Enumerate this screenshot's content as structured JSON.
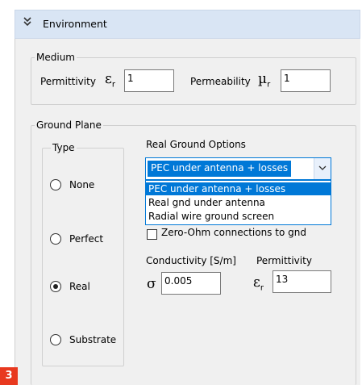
{
  "section": {
    "title": "Environment",
    "collapse_icon": "double-chevron-down-icon"
  },
  "medium": {
    "legend": "Medium",
    "permittivity_label": "Permittivity",
    "permittivity_symbol": "ε",
    "permittivity_sub": "r",
    "permittivity_value": "1",
    "permeability_label": "Permeability",
    "permeability_symbol": "µ",
    "permeability_sub": "r",
    "permeability_value": "1"
  },
  "ground_plane": {
    "legend": "Ground Plane",
    "type": {
      "legend": "Type",
      "options": [
        "None",
        "Perfect",
        "Real",
        "Substrate"
      ],
      "selected": "Real"
    },
    "real_ground": {
      "label": "Real Ground Options",
      "selected": "PEC under antenna + losses",
      "options": [
        "PEC under antenna + losses",
        "Real gnd under antenna",
        "Radial wire ground screen"
      ],
      "checkbox_label": "Zero-Ohm connections to gnd",
      "checkbox_checked": false
    },
    "conductivity": {
      "label": "Conductivity [S/m]",
      "symbol": "σ",
      "value": "0.005"
    },
    "permittivity": {
      "label": "Permittivity",
      "symbol": "ε",
      "sub": "r",
      "value": "13"
    }
  },
  "step_badge": {
    "text": "3",
    "color": "#e8391f"
  },
  "colors": {
    "header_bg": "#d9e5f4",
    "selection": "#0078d7",
    "panel_bg": "#f0f0f0"
  }
}
